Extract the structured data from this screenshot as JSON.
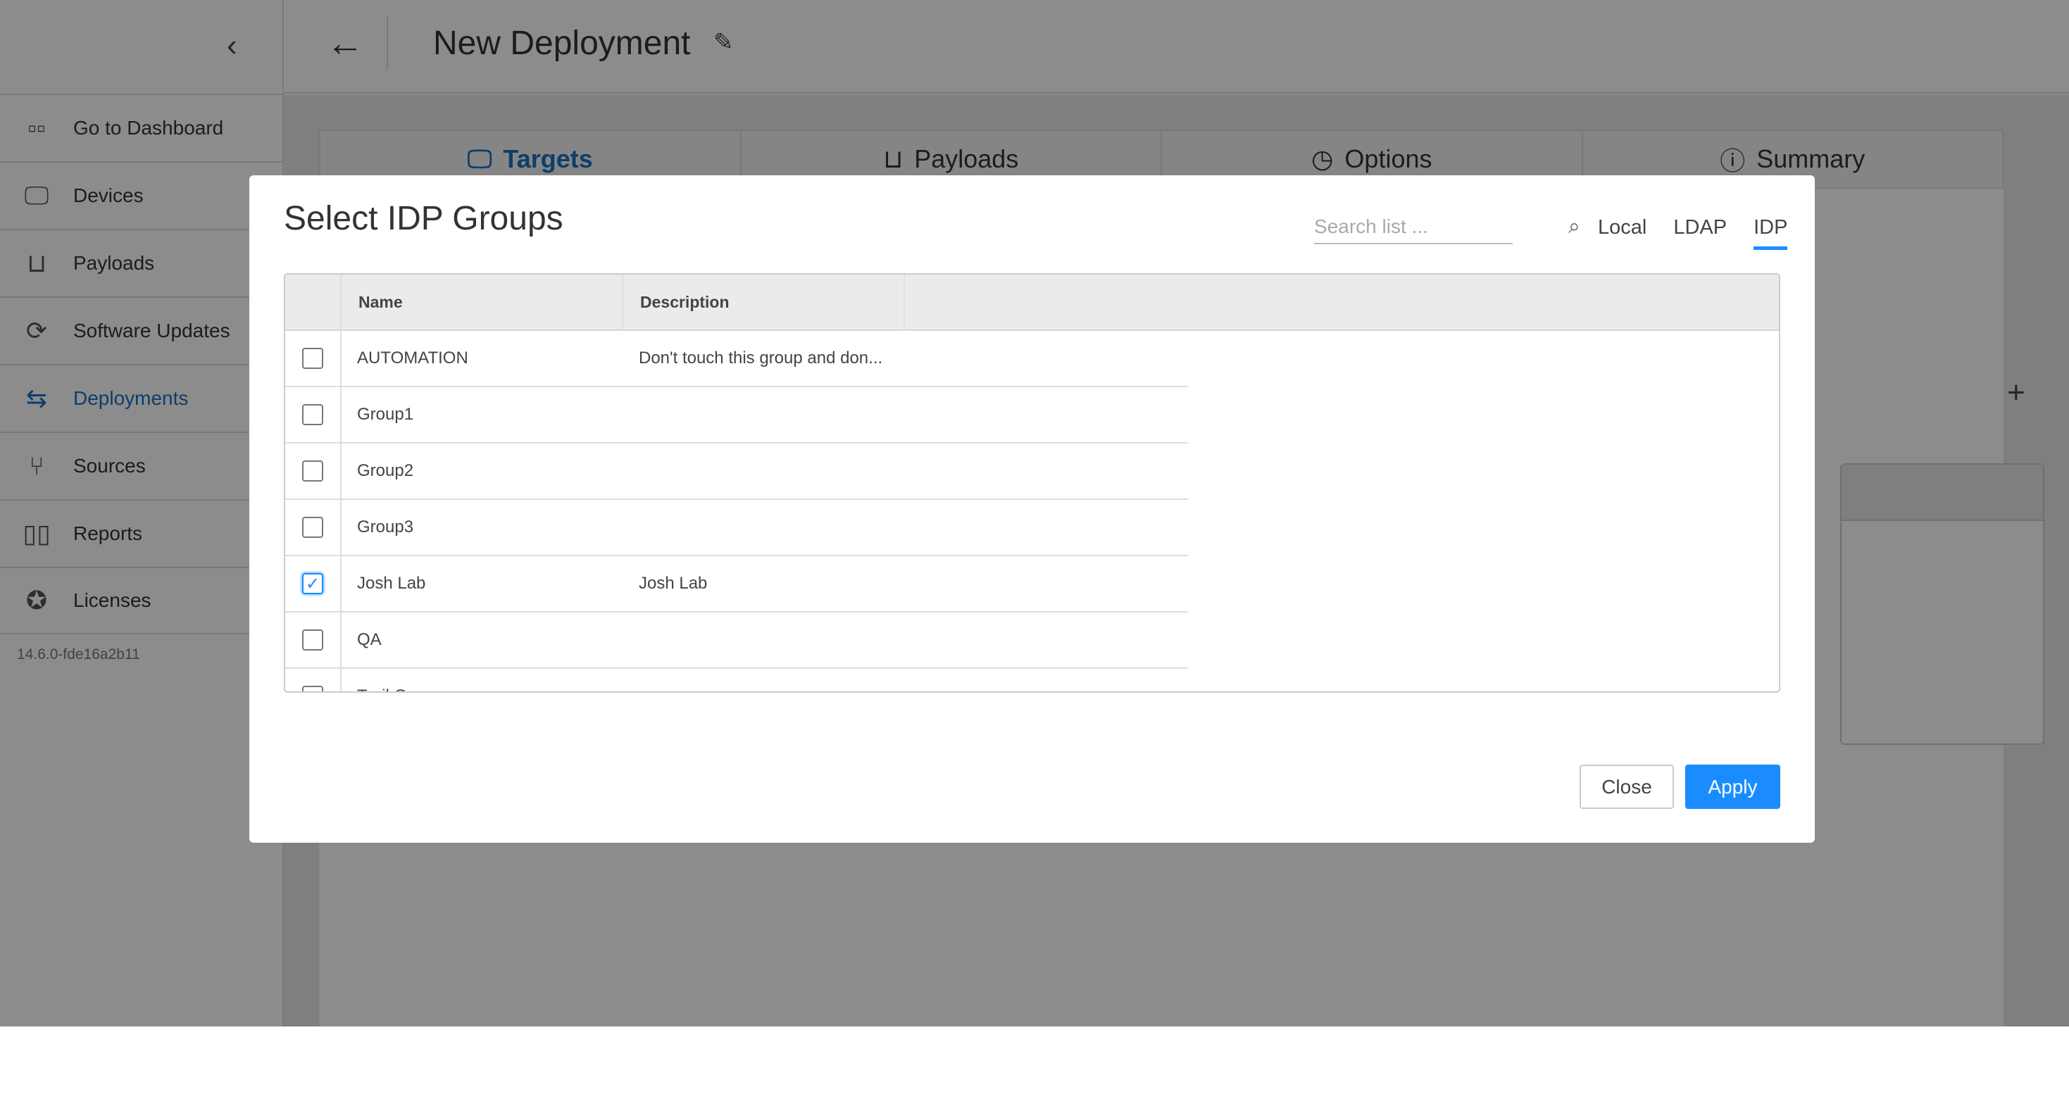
{
  "sidebar": {
    "items": [
      {
        "label": "Go to Dashboard",
        "icon": "dashboard-grid-icon",
        "glyph": "▫▫"
      },
      {
        "label": "Devices",
        "icon": "devices-icon",
        "glyph": "🖵"
      },
      {
        "label": "Payloads",
        "icon": "payloads-inbox-icon",
        "glyph": "⊔"
      },
      {
        "label": "Software Updates",
        "icon": "software-updates-icon",
        "glyph": "⟳"
      },
      {
        "label": "Deployments",
        "icon": "deployments-arrows-icon",
        "glyph": "⇆"
      },
      {
        "label": "Sources",
        "icon": "sources-usb-icon",
        "glyph": "⑂"
      },
      {
        "label": "Reports",
        "icon": "reports-bars-icon",
        "glyph": "▯▯"
      },
      {
        "label": "Licenses",
        "icon": "licenses-badge-icon",
        "glyph": "✪"
      }
    ],
    "active": "Deployments",
    "version": "14.6.0-fde16a2b11"
  },
  "header": {
    "title": "New Deployment"
  },
  "steps": [
    {
      "label": "Targets",
      "glyph": "🖵",
      "active": true
    },
    {
      "label": "Payloads",
      "glyph": "⊔"
    },
    {
      "label": "Options",
      "glyph": "◷"
    },
    {
      "label": "Summary",
      "glyph": "ⓘ"
    }
  ],
  "modal": {
    "title": "Select IDP Groups",
    "search_placeholder": "Search list ...",
    "source_tabs": [
      "Local",
      "LDAP",
      "IDP"
    ],
    "active_tab": "IDP",
    "columns": [
      "Name",
      "Description"
    ],
    "rows": [
      {
        "name": "AUTOMATION",
        "description": "Don't touch this group and don...",
        "checked": false
      },
      {
        "name": "Group1",
        "description": "",
        "checked": false
      },
      {
        "name": "Group2",
        "description": "",
        "checked": false
      },
      {
        "name": "Group3",
        "description": "",
        "checked": false
      },
      {
        "name": "Josh Lab",
        "description": "Josh Lab",
        "checked": true
      },
      {
        "name": "QA",
        "description": "",
        "checked": false
      },
      {
        "name": "Trail G...",
        "description": "",
        "checked": false
      }
    ],
    "close_label": "Close",
    "apply_label": "Apply"
  },
  "colors": {
    "accent": "#1a8cff",
    "nav_active": "#1a6fc4"
  }
}
